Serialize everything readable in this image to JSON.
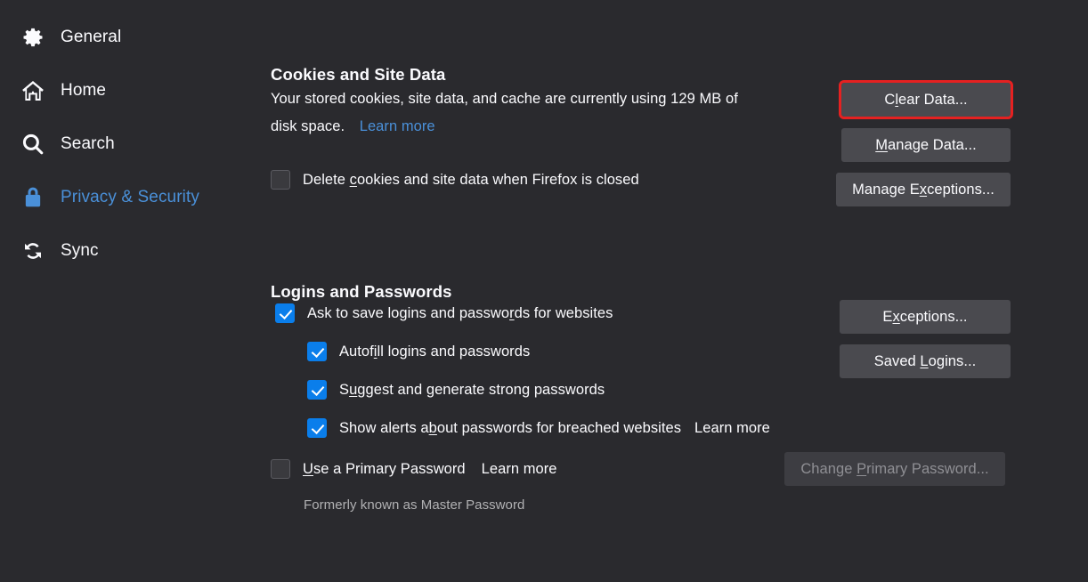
{
  "sidebar": {
    "items": [
      {
        "label": "General",
        "icon": "gear-icon",
        "active": false
      },
      {
        "label": "Home",
        "icon": "home-icon",
        "active": false
      },
      {
        "label": "Search",
        "icon": "search-icon",
        "active": false
      },
      {
        "label": "Privacy & Security",
        "icon": "lock-icon",
        "active": true
      },
      {
        "label": "Sync",
        "icon": "sync-icon",
        "active": false
      }
    ]
  },
  "cookies_section": {
    "title": "Cookies and Site Data",
    "description_line1": "Your stored cookies, site data, and cache are currently using 129 MB of",
    "description_line2": "disk space.",
    "storage_used": "129 MB",
    "learn_more": "Learn more",
    "delete_on_close": {
      "label": "Delete cookies and site data when Firefox is closed",
      "label_pre": "Delete ",
      "label_key": "c",
      "label_post": "ookies and site data when Firefox is closed",
      "checked": false
    },
    "buttons": [
      {
        "name": "clear-data",
        "pre": "C",
        "key": "l",
        "post": "ear Data...",
        "label": "Clear Data...",
        "highlighted": true,
        "disabled": false
      },
      {
        "name": "manage-data",
        "pre": "",
        "key": "M",
        "post": "anage Data...",
        "label": "Manage Data...",
        "highlighted": false,
        "disabled": false
      },
      {
        "name": "manage-exceptions",
        "pre": "Manage E",
        "key": "x",
        "post": "ceptions...",
        "label": "Manage Exceptions...",
        "highlighted": false,
        "disabled": false
      }
    ]
  },
  "logins_section": {
    "title": "Logins and Passwords",
    "ask_to_save": {
      "label": "Ask to save logins and passwords for websites",
      "label_pre": "Ask to save logins and passwo",
      "label_key": "r",
      "label_post": "ds for websites",
      "checked": true
    },
    "autofill": {
      "label": "Autofill logins and passwords",
      "label_pre": "Autof",
      "label_key": "i",
      "label_post": "ll logins and passwords",
      "checked": true
    },
    "suggest_strong": {
      "label": "Suggest and generate strong passwords",
      "label_pre": "S",
      "label_key": "u",
      "label_post": "ggest and generate strong passwords",
      "checked": true
    },
    "breach_alerts": {
      "label": "Show alerts about passwords for breached websites",
      "label_pre": "Show alerts a",
      "label_key": "b",
      "label_post": "out passwords for breached websites",
      "checked": true,
      "learn_more": "Learn more"
    },
    "primary_password": {
      "label": "Use a Primary Password",
      "label_pre": "",
      "label_key": "U",
      "label_post": "se a Primary Password",
      "checked": false,
      "learn_more": "Learn more",
      "note": "Formerly known as Master Password"
    },
    "buttons": [
      {
        "name": "exceptions",
        "pre": "E",
        "key": "x",
        "post": "ceptions...",
        "label": "Exceptions...",
        "disabled": false
      },
      {
        "name": "saved-logins",
        "pre": "Saved ",
        "key": "L",
        "post": "ogins...",
        "label": "Saved Logins...",
        "disabled": false
      },
      {
        "name": "change-primary-password",
        "pre": "Change ",
        "key": "P",
        "post": "rimary Password...",
        "label": "Change Primary Password...",
        "disabled": true
      }
    ]
  },
  "colors": {
    "background": "#2a2a2e",
    "text": "#fbfbfe",
    "link": "#4a90d9",
    "accent_blue": "#0a7eeb",
    "active_nav": "#4a90d9",
    "button_bg": "#4a4a4f",
    "highlight_red": "#e52121",
    "muted_text": "#b1b1b3"
  }
}
